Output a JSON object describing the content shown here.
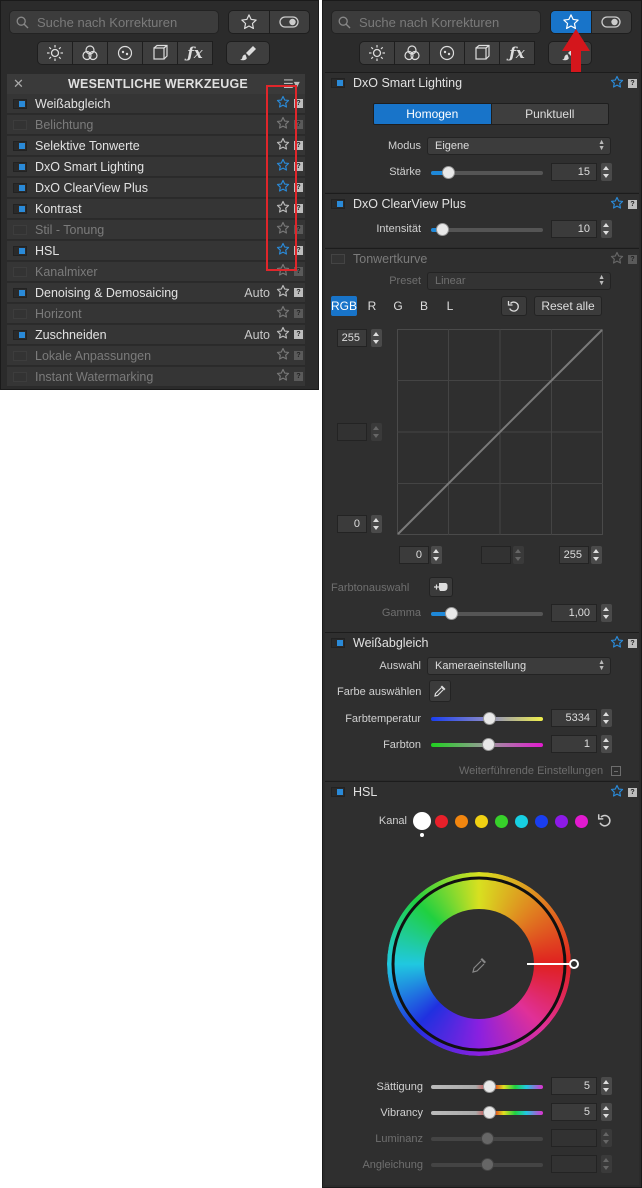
{
  "search": {
    "placeholder": "Suche nach Korrekturen"
  },
  "left": {
    "title": "WESENTLICHE WERKZEUGE",
    "items": [
      {
        "label": "Weißabgleich",
        "enabled": true,
        "fav": true,
        "auto": ""
      },
      {
        "label": "Belichtung",
        "enabled": false,
        "fav": false,
        "auto": ""
      },
      {
        "label": "Selektive Tonwerte",
        "enabled": true,
        "fav": false,
        "auto": ""
      },
      {
        "label": "DxO Smart Lighting",
        "enabled": true,
        "fav": true,
        "auto": ""
      },
      {
        "label": "DxO ClearView Plus",
        "enabled": true,
        "fav": true,
        "auto": ""
      },
      {
        "label": "Kontrast",
        "enabled": true,
        "fav": false,
        "auto": ""
      },
      {
        "label": "Stil - Tonung",
        "enabled": false,
        "fav": false,
        "auto": ""
      },
      {
        "label": "HSL",
        "enabled": true,
        "fav": true,
        "auto": ""
      },
      {
        "label": "Kanalmixer",
        "enabled": false,
        "fav": false,
        "auto": ""
      },
      {
        "label": "Denoising & Demosaicing",
        "enabled": true,
        "fav": false,
        "auto": "Auto"
      },
      {
        "label": "Horizont",
        "enabled": false,
        "fav": false,
        "auto": ""
      },
      {
        "label": "Zuschneiden",
        "enabled": true,
        "fav": false,
        "auto": "Auto"
      },
      {
        "label": "Lokale Anpassungen",
        "enabled": false,
        "fav": false,
        "auto": ""
      },
      {
        "label": "Instant Watermarking",
        "enabled": false,
        "fav": false,
        "auto": ""
      }
    ]
  },
  "help_mark": "?",
  "smart_lighting": {
    "title": "DxO Smart Lighting",
    "tab_homogen": "Homogen",
    "tab_punktuell": "Punktuell",
    "modus_label": "Modus",
    "modus_value": "Eigene",
    "staerke_label": "Stärke",
    "staerke_value": "15",
    "staerke_level": 0.15
  },
  "clearview": {
    "title": "DxO ClearView Plus",
    "intensitaet_label": "Intensität",
    "intensitaet_value": "10",
    "intensitaet_level": 0.1
  },
  "tonwertkurve": {
    "title": "Tonwertkurve",
    "preset_label": "Preset",
    "preset_value": "Linear",
    "channels": [
      "RGB",
      "R",
      "G",
      "B",
      "L"
    ],
    "reset_label": "Reset alle",
    "y_top": "255",
    "y_bottom": "0",
    "x_left": "0",
    "x_right": "255",
    "farbton_label": "Farbtonauswahl",
    "gamma_label": "Gamma",
    "gamma_value": "1,00",
    "gamma_level": 0.18
  },
  "weissabgleich": {
    "title": "Weißabgleich",
    "auswahl_label": "Auswahl",
    "auswahl_value": "Kameraeinstellung",
    "farbe_label": "Farbe auswählen",
    "temp_label": "Farbtemperatur",
    "temp_value": "5334",
    "temp_level": 0.52,
    "farbton_label": "Farbton",
    "farbton_value": "1",
    "farbton_level": 0.51,
    "advanced_label": "Weiterführende Einstellungen"
  },
  "hsl": {
    "title": "HSL",
    "kanal_label": "Kanal",
    "channel_colors": [
      "#ffffff",
      "#e8202a",
      "#f2860f",
      "#f1d113",
      "#37d12a",
      "#17d0e3",
      "#1a3ef0",
      "#8d1ae8",
      "#e21ad0"
    ],
    "saettigung_label": "Sättigung",
    "saettigung_value": "5",
    "saettigung_level": 0.52,
    "vibrancy_label": "Vibrancy",
    "vibrancy_value": "5",
    "vibrancy_level": 0.52,
    "luminanz_label": "Luminanz",
    "luminanz_level": 0.5,
    "angleichung_label": "Angleichung",
    "angleichung_level": 0.5
  }
}
